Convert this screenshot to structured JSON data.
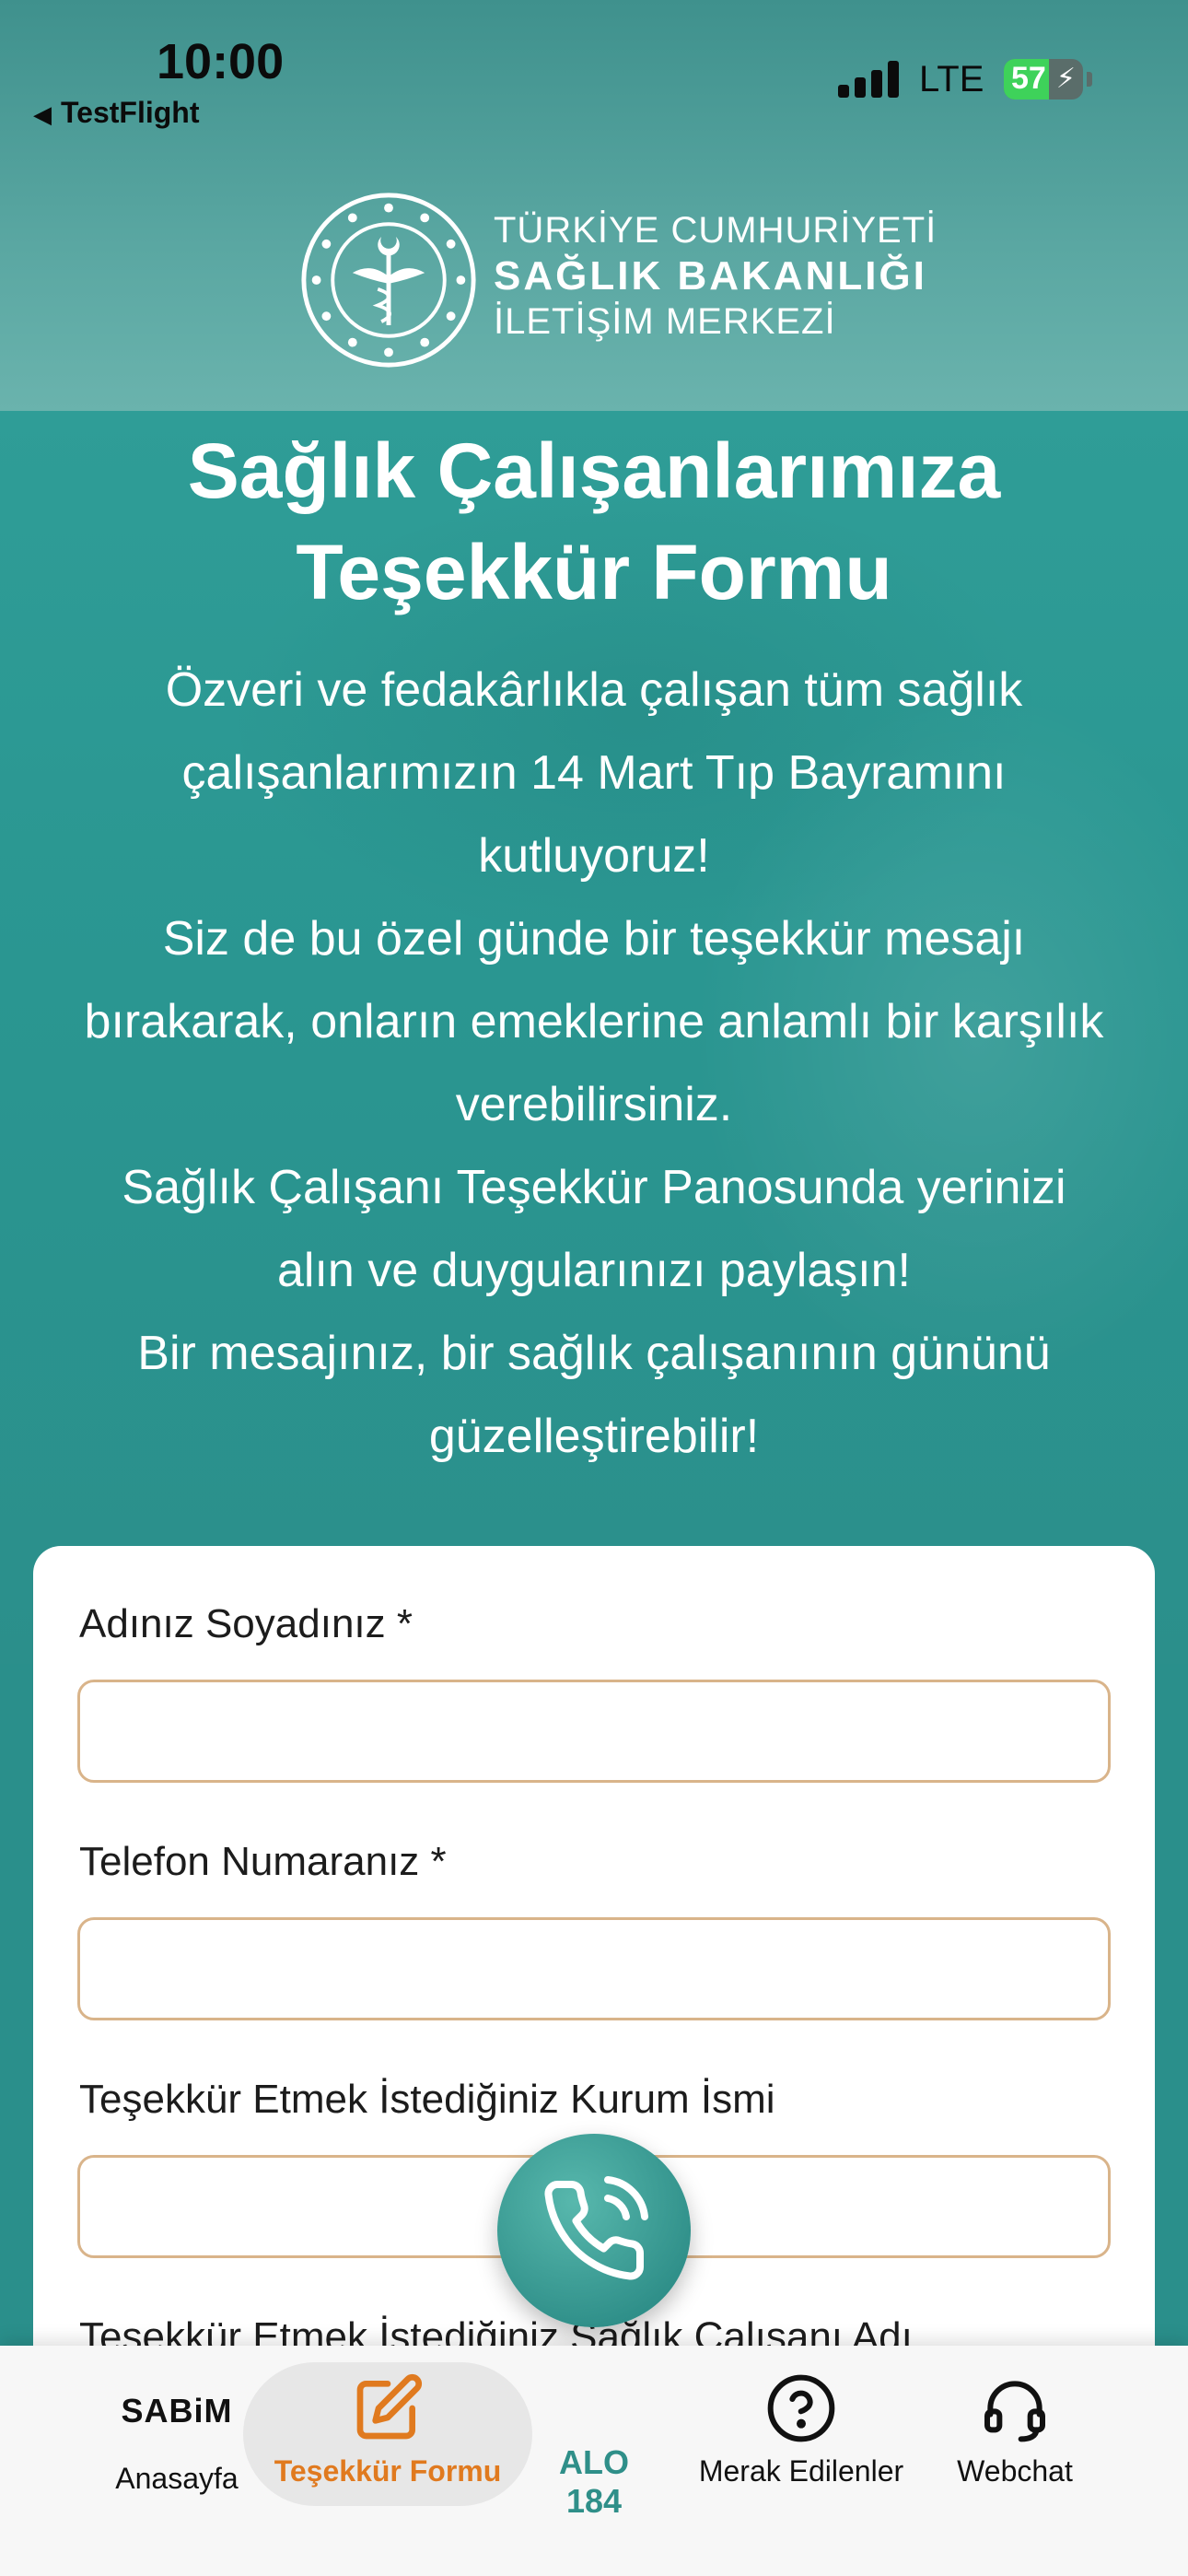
{
  "status_bar": {
    "time": "10:00",
    "back_app": "TestFlight",
    "network": "LTE",
    "battery": "57",
    "battery_level": 0.57
  },
  "header": {
    "logo_line1": "TÜRKİYE CUMHURİYETİ",
    "logo_line2": "SAĞLIK BAKANLIĞI",
    "logo_line3": "İLETİŞİM MERKEZİ"
  },
  "hero": {
    "title_line1": "Sağlık Çalışanlarımıza",
    "title_line2": "Teşekkür Formu",
    "body_lines": [
      "Özveri ve fedakârlıkla çalışan tüm sağlık",
      "çalışanlarımızın 14 Mart Tıp Bayramını",
      "kutluyoruz!",
      "Siz de bu özel günde bir teşekkür mesajı",
      "bırakarak, onların emeklerine anlamlı bir karşılık",
      "verebilirsiniz.",
      "Sağlık Çalışanı Teşekkür Panosunda yerinizi",
      "alın ve duygularınızı paylaşın!",
      "Bir mesajınız, bir sağlık çalışanının gününü",
      "güzelleştirebilir!"
    ]
  },
  "form": {
    "name_label": "Adınız Soyadınız *",
    "name_value": "",
    "phone_label": "Telefon Numaranız *",
    "phone_value": "",
    "institution_label": "Teşekkür Etmek İstediğiniz Kurum İsmi",
    "institution_value": "",
    "worker_label": "Teşekkür Etmek İstediğiniz Sağlık Çalışanı Adı"
  },
  "tabbar": {
    "home_logo": "SABiM",
    "home_label": "Anasayfa",
    "form_label": "Teşekkür Formu",
    "alo_label": "ALO 184",
    "faq_label": "Merak Edilenler",
    "chat_label": "Webchat"
  },
  "colors": {
    "accent": "#2f8f89",
    "active_tab": "#e07a1f",
    "input_border": "#d9b48a"
  },
  "icons": {
    "back": "back-arrow-icon",
    "call": "phone-call-icon",
    "form": "edit-form-icon",
    "faq": "question-circle-icon",
    "chat": "headset-icon"
  }
}
